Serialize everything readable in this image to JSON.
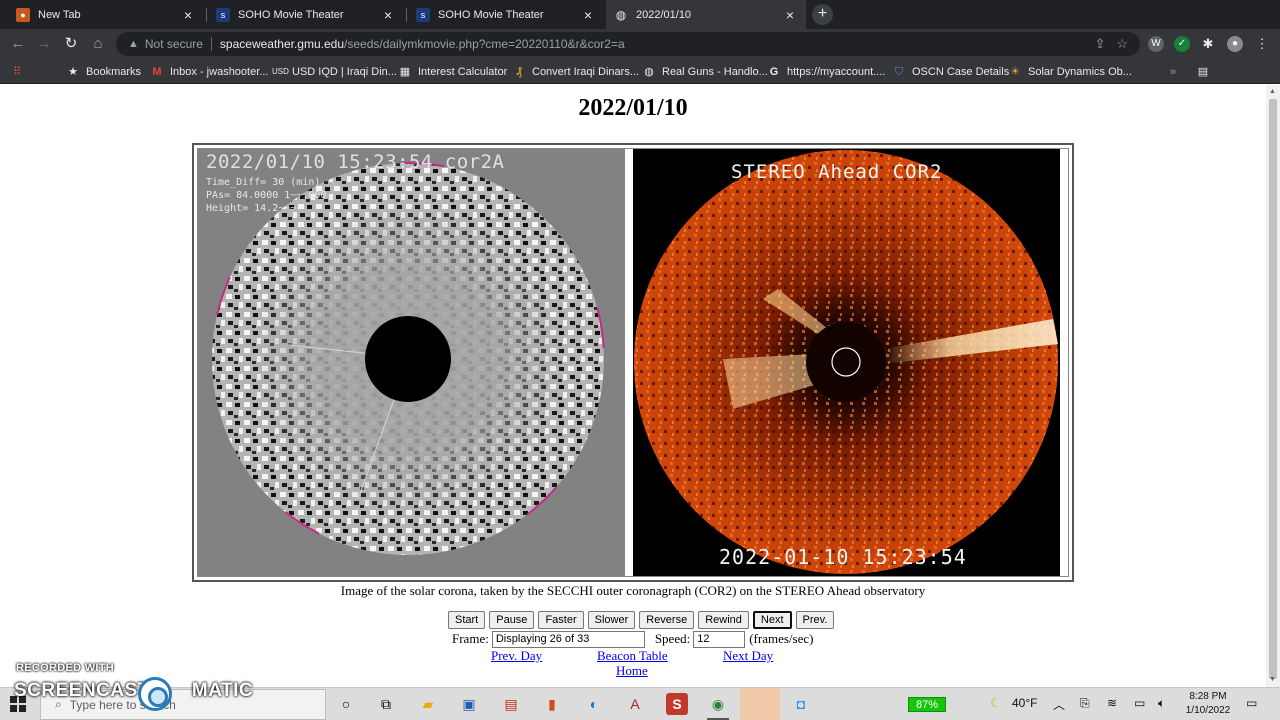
{
  "browser": {
    "tabs": [
      {
        "title": "New Tab",
        "active": false
      },
      {
        "title": "SOHO Movie Theater",
        "active": false
      },
      {
        "title": "SOHO Movie Theater",
        "active": false
      },
      {
        "title": "2022/01/10",
        "active": true
      }
    ],
    "new_tab_label": "+",
    "security_label": "Not secure",
    "url_host": "spaceweather.gmu.edu",
    "url_path": "/seeds/dailymkmovie.php?cme=20220110&r&cor2=a",
    "bookmarks_label": "Bookmarks",
    "bookmarks": [
      {
        "label": "Inbox - jwashooter...",
        "icon": "gmail-icon"
      },
      {
        "label": "USD IQD | Iraqi Din...",
        "icon": "currency-icon"
      },
      {
        "label": "Interest Calculator",
        "icon": "calculator-icon"
      },
      {
        "label": "Convert Iraqi Dinars...",
        "icon": "converter-icon"
      },
      {
        "label": "Real Guns - Handlo...",
        "icon": "globe-icon"
      },
      {
        "label": "https://myaccount....",
        "icon": "google-icon"
      },
      {
        "label": "OSCN Case Details",
        "icon": "shield-icon"
      },
      {
        "label": "Solar Dynamics Ob...",
        "icon": "solar-icon"
      }
    ]
  },
  "page": {
    "title": "2022/01/10",
    "left_image": {
      "stamp": "2022/01/10 15:23:54 cor2A",
      "time_diff": "Time_Diff= 30 (min)",
      "pas": "PAs= 84.0000 1~~.000",
      "height": "Height= 14.2~~~"
    },
    "right_image": {
      "title": "STEREO Ahead COR2",
      "stamp": "2022-01-10 15:23:54"
    },
    "caption": "Image of the solar corona, taken by the SECCHI outer coronagraph (COR2) on the STEREO Ahead observatory",
    "controls": {
      "start": "Start",
      "pause": "Pause",
      "faster": "Faster",
      "slower": "Slower",
      "reverse": "Reverse",
      "rewind": "Rewind",
      "next": "Next",
      "prev": "Prev."
    },
    "frame_label": "Frame:",
    "frame_value": "Displaying 26 of 33",
    "speed_label": "Speed:",
    "speed_value": "12",
    "speed_units": "(frames/sec)",
    "links": {
      "prev_day": "Prev. Day",
      "beacon_table": "Beacon Table",
      "next_day": "Next Day",
      "home": "Home"
    }
  },
  "taskbar": {
    "search_placeholder": "Type here to search",
    "battery": "87%",
    "temperature": "40°F",
    "time": "8:28 PM",
    "date": "1/10/2022"
  },
  "watermark": {
    "recorded_with": "RECORDED WITH",
    "brand": "SCREENCAST",
    "brand_suffix": "MATIC"
  },
  "colors": {
    "chrome_dark": "#202124",
    "chrome_toolbar": "#35363a",
    "link": "#0000ee",
    "corona_orange": "#d2470a"
  }
}
